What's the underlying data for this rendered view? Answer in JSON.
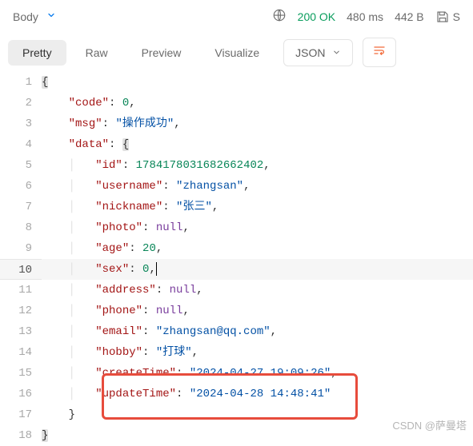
{
  "header": {
    "body_label": "Body",
    "status": "200 OK",
    "time": "480 ms",
    "size": "442 B",
    "save_suffix": "S"
  },
  "tabs": {
    "pretty": "Pretty",
    "raw": "Raw",
    "preview": "Preview",
    "visualize": "Visualize",
    "format": "JSON"
  },
  "code": {
    "line_numbers": [
      "1",
      "2",
      "3",
      "4",
      "5",
      "6",
      "7",
      "8",
      "9",
      "10",
      "11",
      "12",
      "13",
      "14",
      "15",
      "16",
      "17",
      "18"
    ],
    "l1_brace": "{",
    "l2_key": "\"code\"",
    "l2_val": "0",
    "l3_key": "\"msg\"",
    "l3_val": "\"操作成功\"",
    "l4_key": "\"data\"",
    "l4_brace": "{",
    "l5_key": "\"id\"",
    "l5_val": "1784178031682662402",
    "l6_key": "\"username\"",
    "l6_val": "\"zhangsan\"",
    "l7_key": "\"nickname\"",
    "l7_val": "\"张三\"",
    "l8_key": "\"photo\"",
    "l8_val": "null",
    "l9_key": "\"age\"",
    "l9_val": "20",
    "l10_key": "\"sex\"",
    "l10_val": "0",
    "l11_key": "\"address\"",
    "l11_val": "null",
    "l12_key": "\"phone\"",
    "l12_val": "null",
    "l13_key": "\"email\"",
    "l13_val": "\"zhangsan@qq.com\"",
    "l14_key": "\"hobby\"",
    "l14_val": "\"打球\"",
    "l15_key": "\"createTime\"",
    "l15_val": "\"2024-04-27 19:09:26\"",
    "l16_key": "\"updateTime\"",
    "l16_val": "\"2024-04-28 14:48:41\"",
    "l17_brace": "}",
    "l18_brace": "}"
  },
  "watermark": "CSDN @萨曼塔"
}
